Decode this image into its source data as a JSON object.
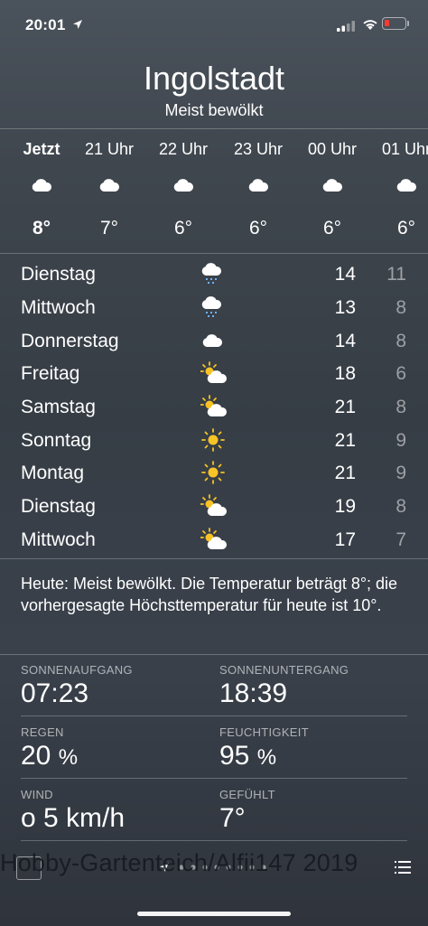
{
  "status": {
    "time": "20:01"
  },
  "header": {
    "city": "Ingolstadt",
    "condition": "Meist bewölkt"
  },
  "hourly": [
    {
      "label": "Jetzt",
      "temp": "8°",
      "icon": "cloud-icon"
    },
    {
      "label": "21 Uhr",
      "temp": "7°",
      "icon": "cloud-icon"
    },
    {
      "label": "22 Uhr",
      "temp": "6°",
      "icon": "cloud-icon"
    },
    {
      "label": "23 Uhr",
      "temp": "6°",
      "icon": "cloud-icon"
    },
    {
      "label": "00 Uhr",
      "temp": "6°",
      "icon": "cloud-icon"
    },
    {
      "label": "01 Uhr",
      "temp": "6°",
      "icon": "cloud-icon"
    }
  ],
  "daily": [
    {
      "day": "Dienstag",
      "high": "14",
      "low": "11",
      "icon": "rain-cloud-icon"
    },
    {
      "day": "Mittwoch",
      "high": "13",
      "low": "8",
      "icon": "rain-cloud-icon"
    },
    {
      "day": "Donnerstag",
      "high": "14",
      "low": "8",
      "icon": "cloud-icon"
    },
    {
      "day": "Freitag",
      "high": "18",
      "low": "6",
      "icon": "partly-sunny-icon"
    },
    {
      "day": "Samstag",
      "high": "21",
      "low": "8",
      "icon": "partly-sunny-icon"
    },
    {
      "day": "Sonntag",
      "high": "21",
      "low": "9",
      "icon": "sun-icon"
    },
    {
      "day": "Montag",
      "high": "21",
      "low": "9",
      "icon": "sun-icon"
    },
    {
      "day": "Dienstag",
      "high": "19",
      "low": "8",
      "icon": "partly-sunny-icon"
    },
    {
      "day": "Mittwoch",
      "high": "17",
      "low": "7",
      "icon": "partly-sunny-icon"
    }
  ],
  "summary": "Heute: Meist bewölkt. Die Temperatur beträgt 8°; die vorhergesagte Höchsttemperatur für heute ist 10°.",
  "details": {
    "sunrise_label": "SONNENAUFGANG",
    "sunrise_value": "07:23",
    "sunset_label": "SONNENUNTERGANG",
    "sunset_value": "18:39",
    "rain_label": "REGEN",
    "rain_value": "20",
    "rain_unit": "%",
    "humidity_label": "FEUCHTIGKEIT",
    "humidity_value": "95",
    "humidity_unit": "%",
    "wind_label": "WIND",
    "wind_value": "o 5 km/h",
    "feels_label": "GEFÜHLT",
    "feels_value": "7°"
  },
  "watermark": "Hobby-Gartenteich/Alfii147 2019",
  "colors": {
    "sun": "#f7c325",
    "battery_low": "#ff3b30"
  }
}
